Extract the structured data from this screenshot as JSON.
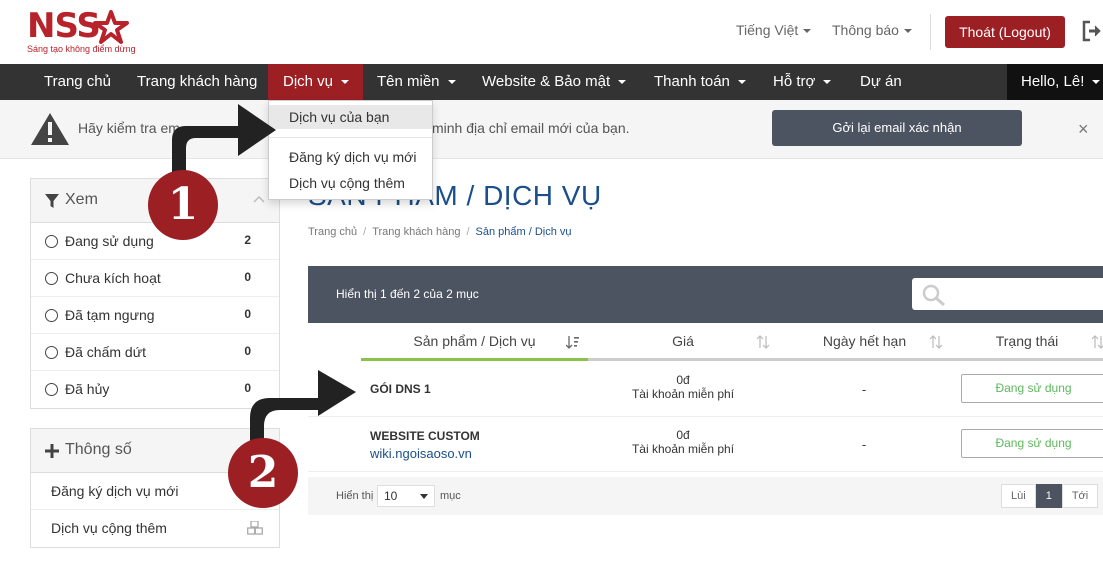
{
  "header": {
    "logo_text": "NSS",
    "logo_tagline": "Sáng tạo không điểm dừng",
    "language": "Tiếng Việt",
    "notifications": "Thông báo",
    "logout_label": "Thoát (Logout)"
  },
  "nav": {
    "items": [
      {
        "label": "Trang chủ"
      },
      {
        "label": "Trang khách hàng"
      },
      {
        "label": "Dịch vụ"
      },
      {
        "label": "Tên miền"
      },
      {
        "label": "Website & Bảo mật"
      },
      {
        "label": "Thanh toán"
      },
      {
        "label": "Hỗ trợ"
      },
      {
        "label": "Dự án"
      }
    ],
    "greeting": "Hello, Lê!"
  },
  "dropdown": {
    "items": [
      {
        "label": "Dịch vụ của bạn"
      },
      {
        "label": "Đăng ký dịch vụ mới"
      },
      {
        "label": "Dịch vụ cộng thêm"
      }
    ]
  },
  "alert": {
    "text_left": "Hãy kiểm tra em",
    "text_right": "minh địa chỉ email mới của bạn.",
    "resend_label": "Gởi lại email xác nhận",
    "close_label": "×"
  },
  "sidebar": {
    "filter_title": "Xem",
    "filters": [
      {
        "label": "Đang sử dụng",
        "count": "2"
      },
      {
        "label": "Chưa kích hoạt",
        "count": "0"
      },
      {
        "label": "Đã tạm ngưng",
        "count": "0"
      },
      {
        "label": "Đã chấm dứt",
        "count": "0"
      },
      {
        "label": "Đã hủy",
        "count": "0"
      }
    ],
    "params_title": "Thông số",
    "params": [
      {
        "label": "Đăng ký dịch vụ mới"
      },
      {
        "label": "Dịch vụ cộng thêm"
      }
    ]
  },
  "main": {
    "title": "SẢN PHẨM / DỊCH VỤ",
    "breadcrumb": [
      "Trang chủ",
      "Trang khách hàng",
      "Sản phẩm / Dịch vụ"
    ],
    "showing": "Hiển thị 1 đến 2 của 2 mục",
    "columns": [
      "Sản phẩm / Dịch vụ",
      "Giá",
      "Ngày hết hạn",
      "Trạng thái"
    ],
    "rows": [
      {
        "name": "GÓI DNS 1",
        "link": "",
        "price": "0đ",
        "price_note": "Tài khoản miễn phí",
        "expiry": "-",
        "status": "Đang sử dụng"
      },
      {
        "name": "WEBSITE CUSTOM",
        "link": "wiki.ngoisaoso.vn",
        "price": "0đ",
        "price_note": "Tài khoản miễn phí",
        "expiry": "-",
        "status": "Đang sử dụng"
      }
    ],
    "footer": {
      "show_label": "Hiển thị",
      "page_size": "10",
      "entries_label": "mục",
      "prev": "Lùi",
      "current": "1",
      "next": "Tới"
    }
  },
  "callouts": [
    "1",
    "2"
  ],
  "colors": {
    "brand": "#9c1f24",
    "nav": "#333333",
    "title": "#1a4f8b",
    "status": "#5cb85c"
  }
}
